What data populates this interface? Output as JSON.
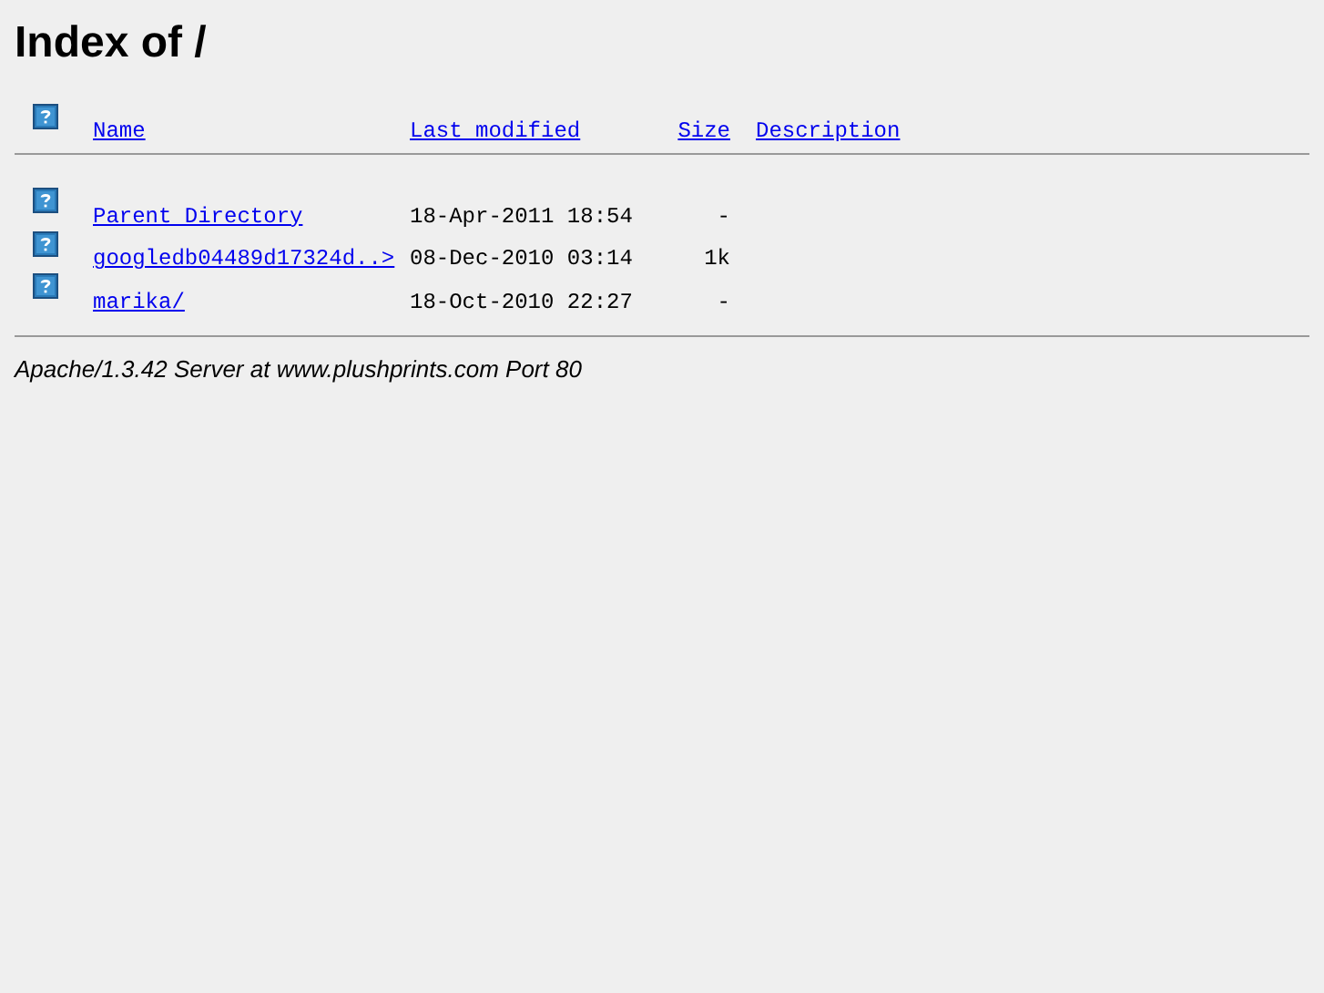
{
  "title": "Index of /",
  "columns": [
    "Name",
    "Last modified",
    "Size",
    "Description"
  ],
  "rows": [
    {
      "name": "Parent Directory",
      "modified": "18-Apr-2011 18:54",
      "size": "-"
    },
    {
      "name": "googledb04489d17324d..>",
      "modified": "08-Dec-2010 03:14",
      "size": "1k"
    },
    {
      "name": "marika/",
      "modified": "18-Oct-2010 22:27",
      "size": "-"
    }
  ],
  "footer": "Apache/1.3.42 Server at www.plushprints.com Port 80"
}
